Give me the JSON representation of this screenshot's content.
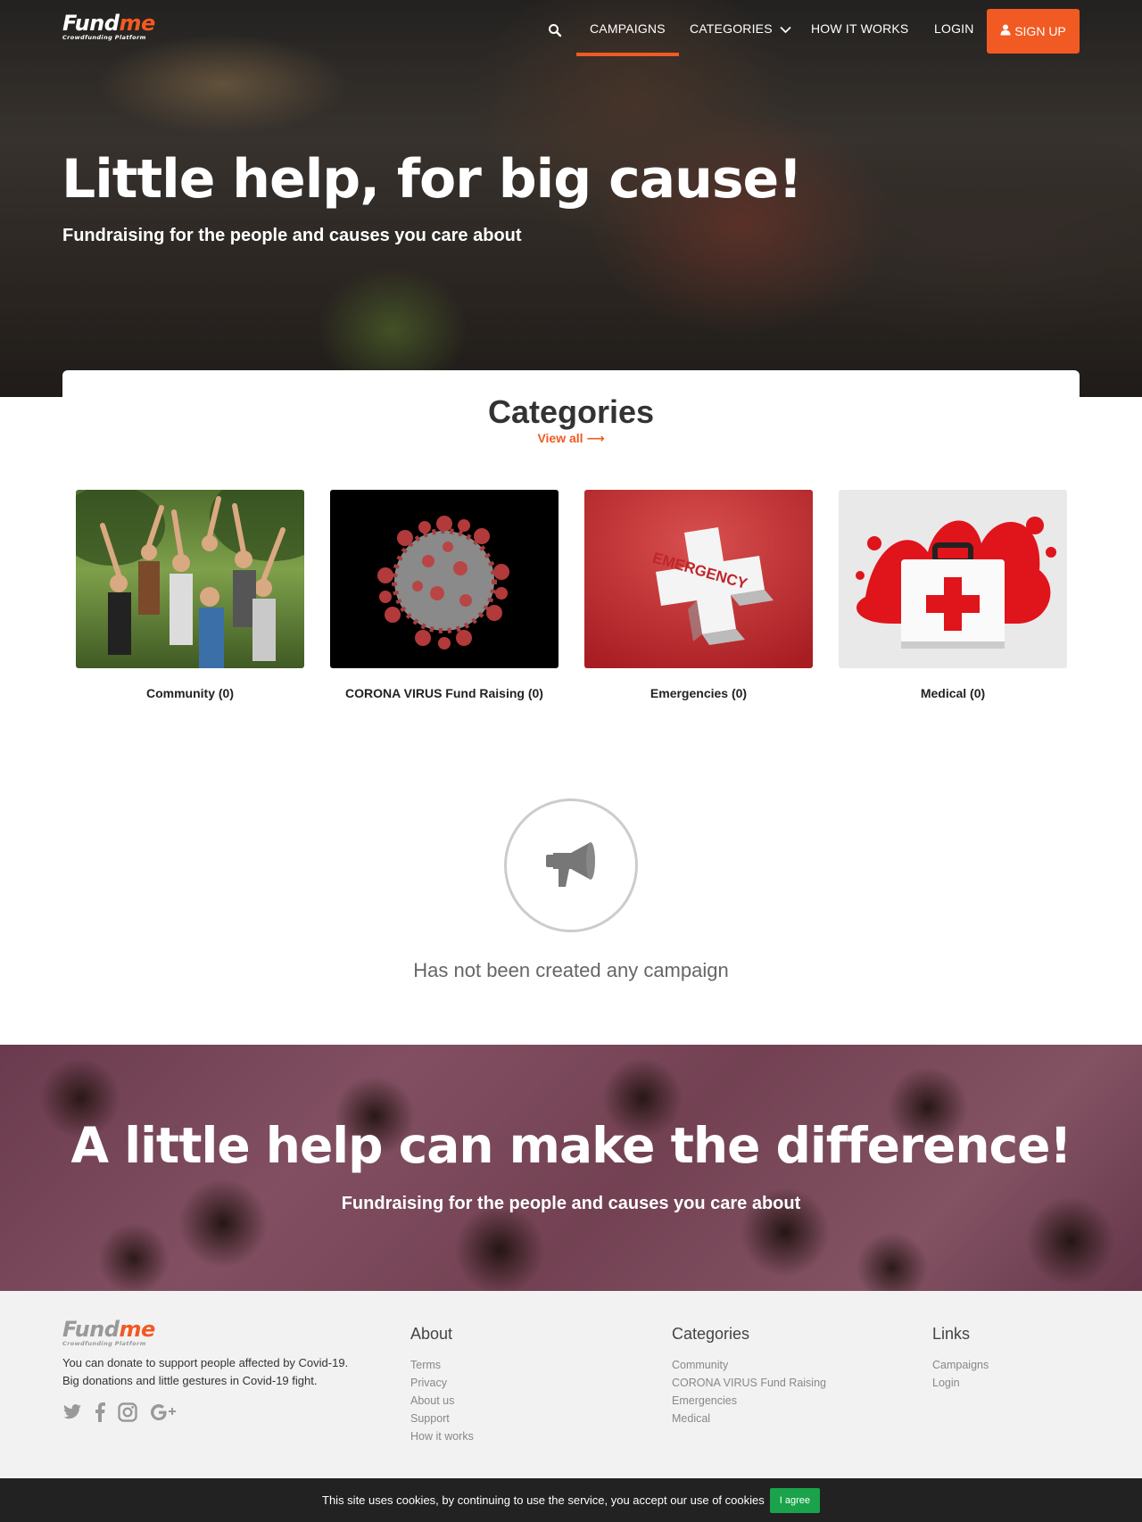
{
  "brand": {
    "logo_part1": "Fund",
    "logo_part2": "me",
    "logo_tagline": "Crowdfunding Platform",
    "accent_color": "#f15a22"
  },
  "nav": {
    "search_icon": "search-icon",
    "campaigns": "CAMPAIGNS",
    "categories": "CATEGORIES",
    "how_it_works": "HOW IT WORKS",
    "login": "LOGIN",
    "signup": "SIGN UP"
  },
  "hero": {
    "title": "Little help, for big cause!",
    "subtitle": "Fundraising for the people and causes you care about"
  },
  "categories": {
    "heading": "Categories",
    "view_all": "View all ⟶",
    "items": [
      {
        "label": "Community (0)",
        "image": "community-photo",
        "image_text": ""
      },
      {
        "label": "CORONA VIRUS Fund Raising (0)",
        "image": "virus-photo",
        "image_text": ""
      },
      {
        "label": "Emergencies (0)",
        "image": "emergency-photo",
        "image_text": "EMERGENCY"
      },
      {
        "label": "Medical (0)",
        "image": "medical-kit-photo",
        "image_text": ""
      }
    ]
  },
  "empty_state": {
    "icon": "megaphone-icon",
    "message": "Has not been created any campaign"
  },
  "banner": {
    "title": "A little help can make the difference!",
    "subtitle": "Fundraising for the people and causes you care about"
  },
  "footer": {
    "description_line1": "You can donate to support people affected by Covid-19.",
    "description_line2": "Big donations and little gestures in Covid-19 fight.",
    "social": [
      "twitter-icon",
      "facebook-icon",
      "instagram-icon",
      "google-plus-icon"
    ],
    "about": {
      "title": "About",
      "links": [
        "Terms",
        "Privacy",
        "About us",
        "Support",
        "How it works"
      ]
    },
    "categories": {
      "title": "Categories",
      "links": [
        "Community",
        "CORONA VIRUS Fund Raising",
        "Emergencies",
        "Medical"
      ]
    },
    "links": {
      "title": "Links",
      "links": [
        "Campaigns",
        "Login"
      ]
    }
  },
  "cookie": {
    "message": "This site uses cookies, by continuing to use the service, you accept our use of cookies",
    "button": "I agree",
    "button_color": "#1aa34a"
  }
}
